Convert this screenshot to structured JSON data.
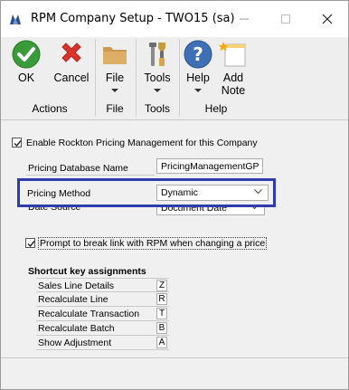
{
  "window": {
    "title": "RPM Company Setup  -  TWO15 (sa)",
    "icon": "app-logo-icon"
  },
  "ribbon": {
    "groups": [
      {
        "label": "Actions",
        "buttons": [
          {
            "label": "OK",
            "icon": "ok-check-icon"
          },
          {
            "label": "Cancel",
            "icon": "cancel-x-icon"
          }
        ]
      },
      {
        "label": "File",
        "buttons": [
          {
            "label": "File",
            "icon": "folder-icon",
            "dropdown": true
          }
        ]
      },
      {
        "label": "Tools",
        "buttons": [
          {
            "label": "Tools",
            "icon": "tools-icon",
            "dropdown": true
          }
        ]
      },
      {
        "label": "Help",
        "buttons": [
          {
            "label": "Help",
            "icon": "help-question-icon",
            "dropdown": true
          },
          {
            "label": "Add\nNote",
            "icon": "add-note-icon"
          }
        ]
      }
    ]
  },
  "form": {
    "enable_label": "Enable Rockton Pricing Management for this Company",
    "enable_checked": true,
    "db_name_label": "Pricing Database Name",
    "db_name_value": "PricingManagementGP",
    "pricing_method_label": "Pricing Method",
    "pricing_method_value": "Dynamic",
    "date_source_label": "Date Source",
    "date_source_value": "Document Date",
    "prompt_label": "Prompt to break link with RPM when changing a price",
    "prompt_checked": true,
    "highlight_color": "#2f3cad"
  },
  "shortcuts": {
    "title": "Shortcut key assignments",
    "rows": [
      {
        "name": "Sales Line Details",
        "key": "Z"
      },
      {
        "name": "Recalculate Line",
        "key": "R"
      },
      {
        "name": "Recalculate Transaction",
        "key": "T"
      },
      {
        "name": "Recalculate Batch",
        "key": "B"
      },
      {
        "name": "Show Adjustment",
        "key": "A"
      }
    ]
  }
}
